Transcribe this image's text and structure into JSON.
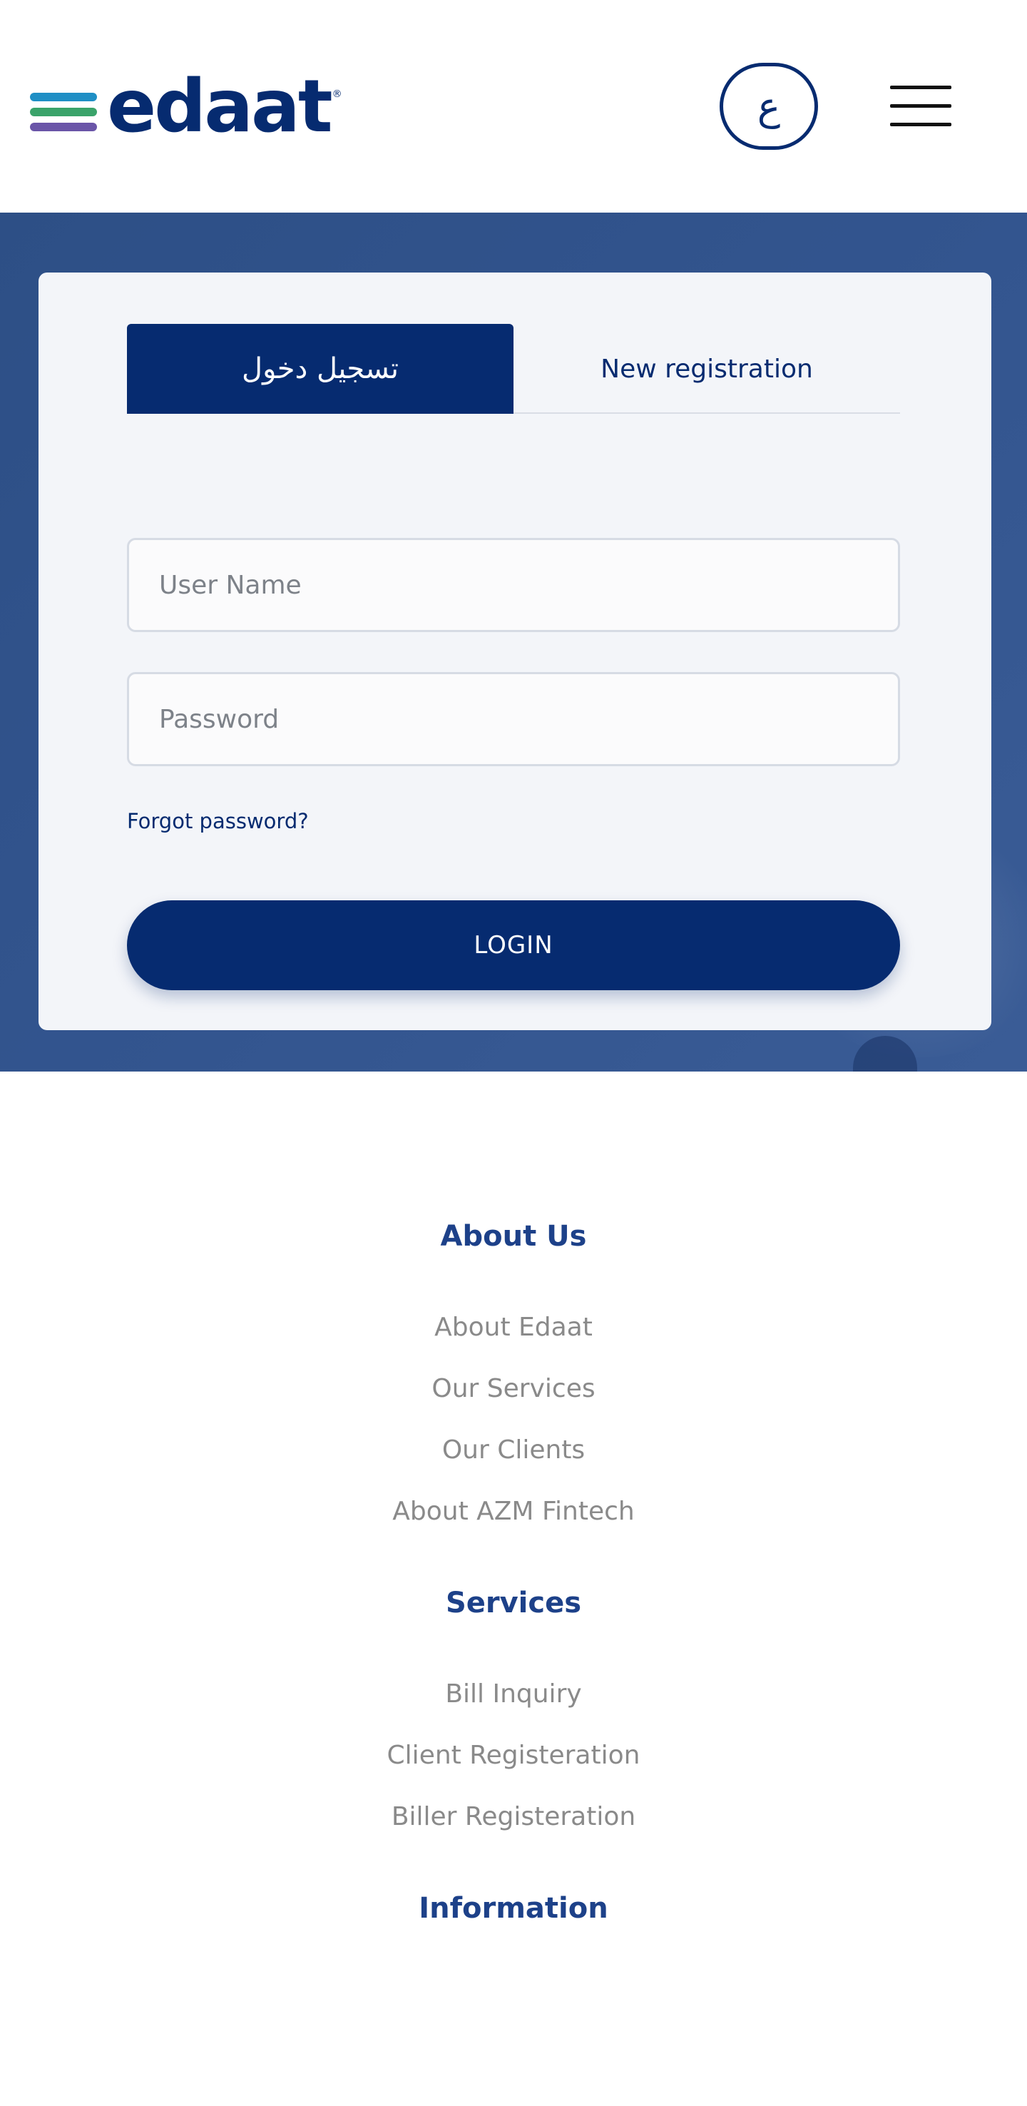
{
  "header": {
    "logo_text": "edaat",
    "logo_reg": "®",
    "logo_colors": [
      "#1f8fc5",
      "#3aa36a",
      "#6a55a8"
    ],
    "lang_toggle": "ع",
    "menu_icon": "hamburger-menu-icon"
  },
  "login_card": {
    "tabs": [
      {
        "label": "تسجيل دخول",
        "active": true
      },
      {
        "label": "New registration",
        "active": false
      }
    ],
    "username_placeholder": "User Name",
    "password_placeholder": "Password",
    "forgot_password": "Forgot password?",
    "login_button": "LOGIN"
  },
  "footer": {
    "sections": [
      {
        "title": "About Us",
        "links": [
          "About Edaat",
          "Our Services",
          "Our Clients",
          "About AZM Fintech"
        ]
      },
      {
        "title": "Services",
        "links": [
          "Bill Inquiry",
          "Client Registeration",
          "Biller Registeration"
        ]
      },
      {
        "title": "Information",
        "links": []
      }
    ]
  },
  "colors": {
    "primary": "#062b70",
    "hero_bg": "#33558f",
    "card_bg": "#f3f5f9",
    "footer_heading": "#1d4189",
    "footer_link": "#8a8a8a"
  }
}
